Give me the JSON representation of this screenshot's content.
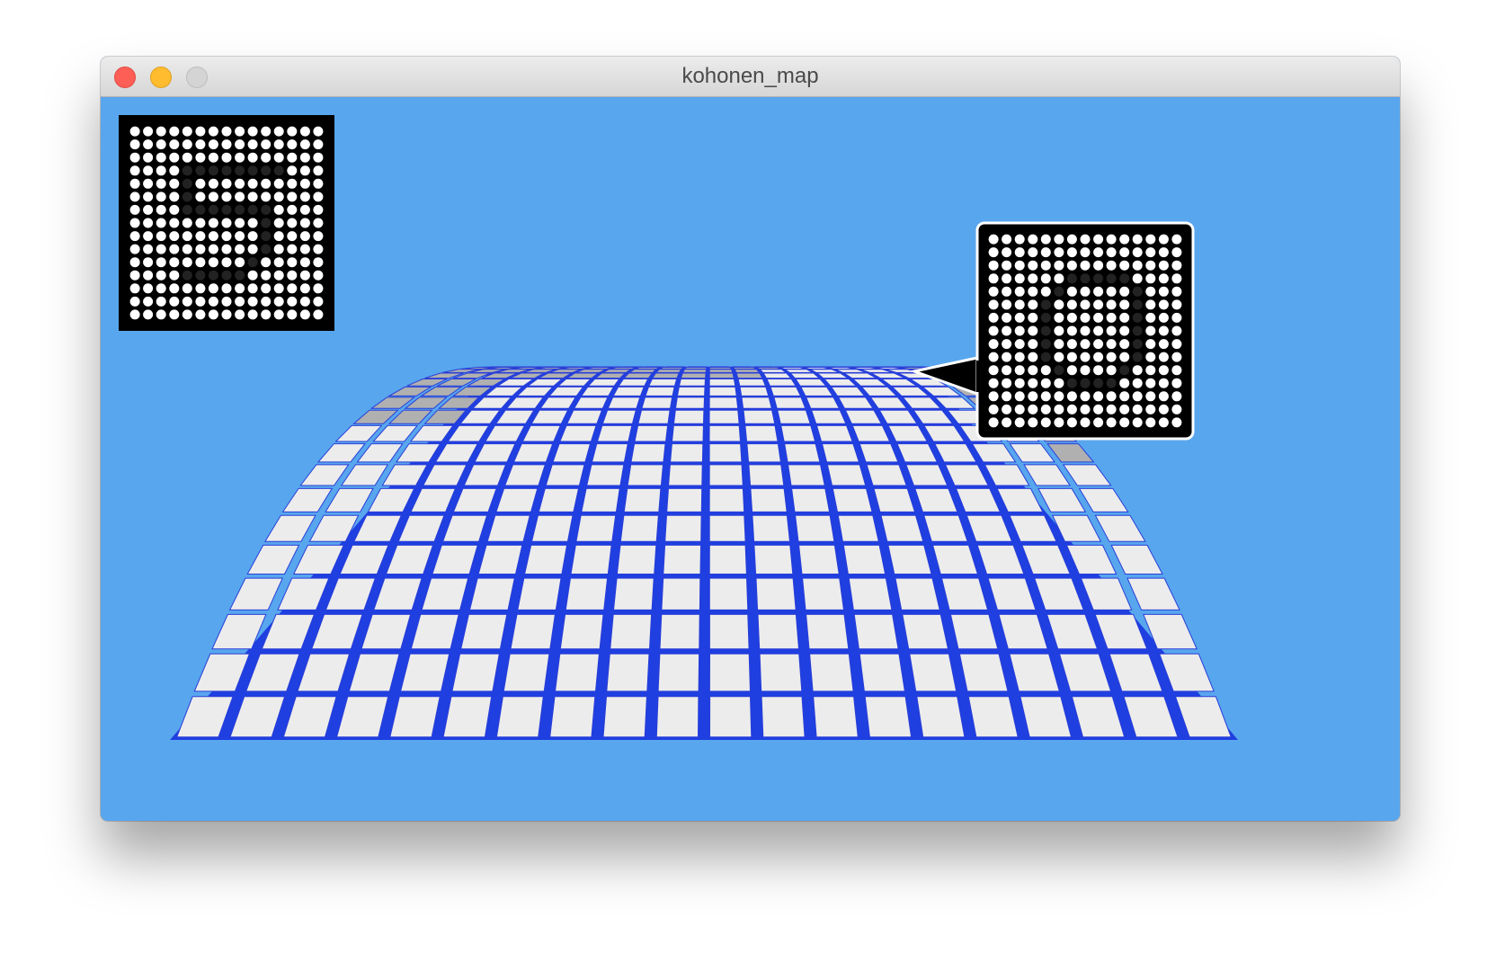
{
  "window": {
    "title": "kohonen_map"
  },
  "colors": {
    "background": "#58a6ee",
    "grid_line": "#1f3fe0",
    "cell_light": "#ececec",
    "cell_dark": "#b0b0b0"
  },
  "icons": {
    "close": "close-icon",
    "minimize": "minimize-icon",
    "zoom": "zoom-icon"
  },
  "input_digit": [
    "...............",
    "...............",
    "...............",
    "....########...",
    "....#..........",
    "....#..........",
    "....#######....",
    "..........#....",
    "..........#....",
    "..........#....",
    ".........#.....",
    "....#####......",
    "...............",
    "...............",
    "..............."
  ],
  "selected_neuron_digit": [
    "...............",
    "...............",
    "...............",
    "......#####....",
    ".....#.....#...",
    "....#......#...",
    "....#......#...",
    "....#......#...",
    "....#......#...",
    "....#......#...",
    ".....#....#....",
    "......####.....",
    "...............",
    "...............",
    "..............."
  ],
  "map_shading": [
    "11111111111111111111",
    "11111111111111111111",
    "11111111111111111111",
    "11111111111111111111",
    "11111111111111111111",
    "11111111111111111111",
    "11111111111111111111",
    "11111111111111111111",
    "11111111111111111110",
    "11111111111111111110",
    "00011111111111111110",
    "00011111111111111100",
    "00011111111111111100",
    "00011111111111111100",
    "00000000000011111100",
    "00000000000011111100",
    "00000000000001111100",
    "00000000000000000000"
  ]
}
